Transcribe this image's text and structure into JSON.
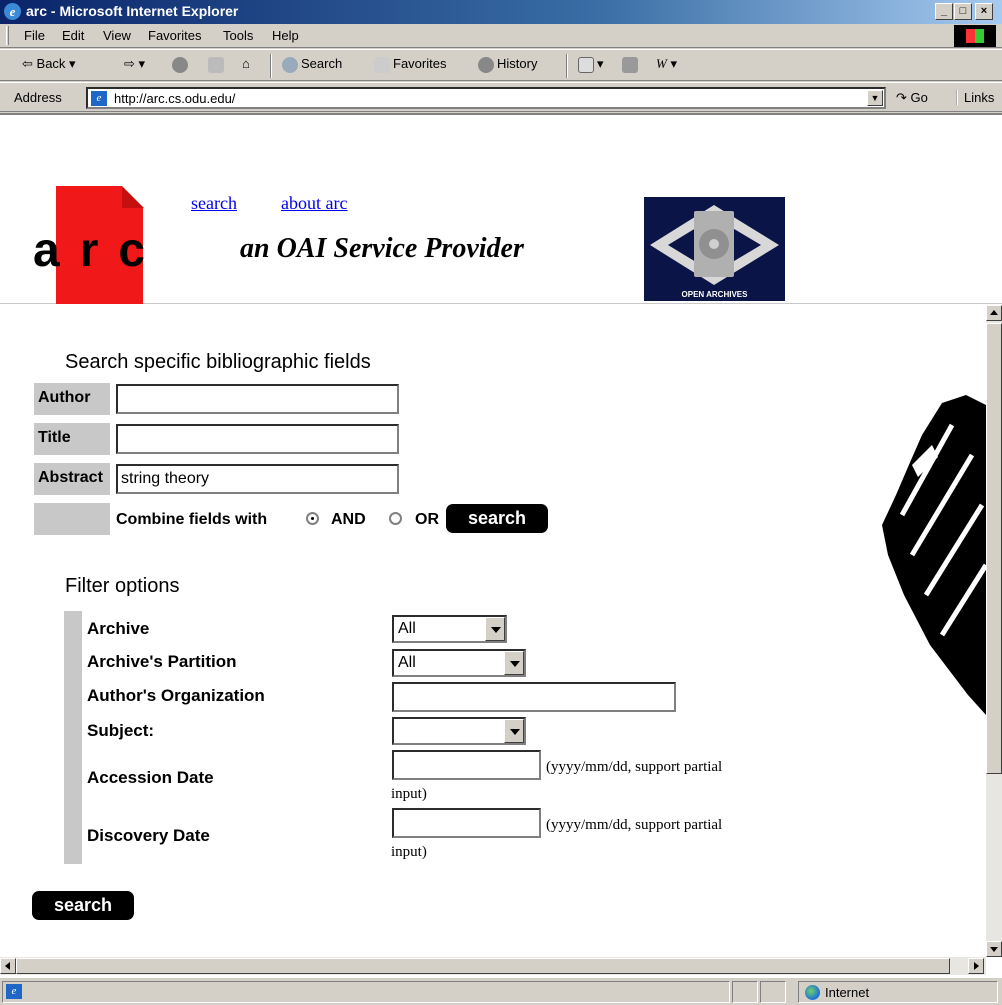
{
  "window": {
    "title": "arc - Microsoft Internet Explorer"
  },
  "menu": [
    "File",
    "Edit",
    "View",
    "Favorites",
    "Tools",
    "Help"
  ],
  "toolbar": {
    "back": "Back",
    "search": "Search",
    "favorites": "Favorites",
    "history": "History"
  },
  "address": {
    "label": "Address",
    "url": "http://arc.cs.odu.edu/",
    "go": "Go",
    "links": "Links"
  },
  "header": {
    "logo_text": "arc",
    "links": [
      "search",
      "about arc"
    ],
    "tagline": "an OAI Service Provider",
    "oa_logo_label": "OPEN ARCHIVES"
  },
  "search_fields": {
    "title": "Search specific bibliographic fields",
    "fields": [
      {
        "label": "Author",
        "value": ""
      },
      {
        "label": "Title",
        "value": ""
      },
      {
        "label": "Abstract",
        "value": "string theory"
      }
    ],
    "combine_label": "Combine fields with",
    "options": [
      "AND",
      "OR"
    ],
    "selected": "AND",
    "button": "search"
  },
  "filters": {
    "title": "Filter options",
    "archive": {
      "label": "Archive",
      "value": "All"
    },
    "partition": {
      "label": "Archive's Partition",
      "value": "All"
    },
    "organization": {
      "label": "Author's Organization",
      "value": ""
    },
    "subject": {
      "label": "Subject:",
      "value": ""
    },
    "accession": {
      "label": "Accession Date",
      "hint": "(yyyy/mm/dd, support partial",
      "hint2": "input)"
    },
    "discovery": {
      "label": "Discovery Date",
      "hint": "(yyyy/mm/dd, support partial",
      "hint2": "input)"
    },
    "button": "search"
  },
  "status": {
    "zone": "Internet"
  },
  "colors": {
    "titlebar": "#0a246a",
    "logo_red": "#f01818",
    "link": "#0000ee",
    "chrome": "#d4d0c8"
  }
}
